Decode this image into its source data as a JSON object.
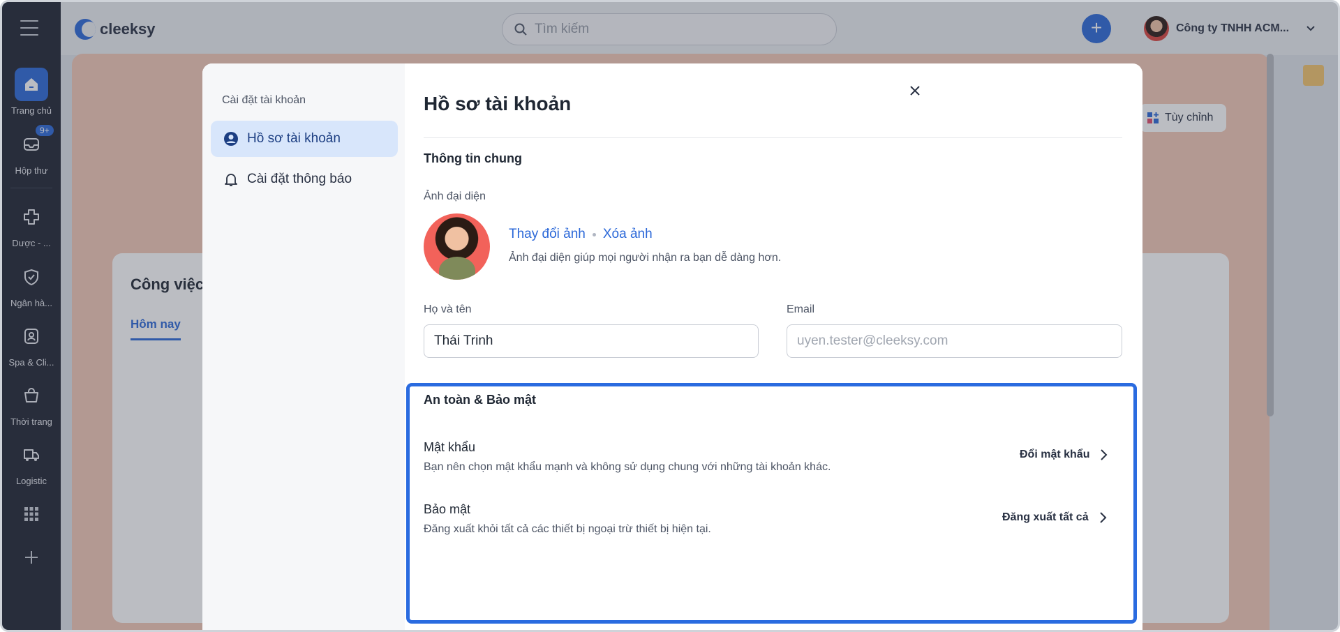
{
  "app": {
    "logo_text": "cleeksy"
  },
  "search": {
    "placeholder": "Tìm kiếm"
  },
  "header": {
    "add_label": "+",
    "company_name": "Công ty TNHH ACM..."
  },
  "sidebar": {
    "items": [
      {
        "label": "Trang chủ",
        "icon": "home-icon"
      },
      {
        "label": "Hộp thư",
        "icon": "inbox-icon",
        "badge": "9+"
      },
      {
        "label": "Dược - ...",
        "icon": "pharmacy-icon"
      },
      {
        "label": "Ngân hà...",
        "icon": "bank-icon"
      },
      {
        "label": "Spa & Cli...",
        "icon": "spa-icon"
      },
      {
        "label": "Thời trang",
        "icon": "fashion-icon"
      },
      {
        "label": "Logistic",
        "icon": "truck-icon"
      }
    ]
  },
  "background": {
    "card_title": "Công việc",
    "tab_today": "Hôm nay",
    "customize_label": "Tùy chỉnh"
  },
  "modal": {
    "sidebar_heading": "Cài đặt tài khoản",
    "nav": [
      {
        "label": "Hồ sơ tài khoản",
        "active": true
      },
      {
        "label": "Cài đặt thông báo",
        "active": false
      }
    ],
    "title": "Hồ sơ tài khoản",
    "general_title": "Thông tin chung",
    "avatar_label": "Ảnh đại diện",
    "change_photo": "Thay đổi ảnh",
    "delete_photo": "Xóa ảnh",
    "avatar_hint": "Ảnh đại diện giúp mọi người nhận ra bạn dễ dàng hơn.",
    "name_label": "Họ và tên",
    "name_value": "Thái Trinh",
    "email_label": "Email",
    "email_placeholder": "uyen.tester@cleeksy.com",
    "security": {
      "title": "An toàn & Bảo mật",
      "password_title": "Mật khẩu",
      "password_desc": "Bạn nên chọn mật khẩu mạnh và không sử dụng chung với những tài khoản khác.",
      "password_action": "Đổi mật khẩu",
      "security_title": "Bảo mật",
      "security_desc": "Đăng xuất khỏi tất cả các thiết bị ngoại trừ thiết bị hiện tại.",
      "security_action": "Đăng xuất tất cả"
    }
  },
  "colors": {
    "accent": "#2a67d8",
    "rail": "#1e2230",
    "highlight_border": "#2a6be0"
  }
}
